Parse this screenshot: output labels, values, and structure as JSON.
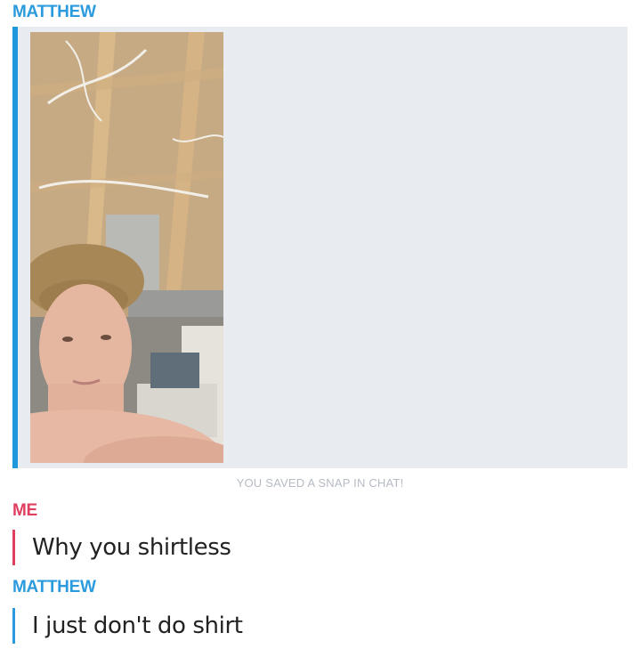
{
  "chat": {
    "senders": {
      "matthew": "MATTHEW",
      "me": "ME"
    },
    "snap": {
      "saved_notice": "YOU SAVED A SNAP IN CHAT!"
    },
    "messages": [
      {
        "sender": "ME",
        "text": "Why you shirtless"
      },
      {
        "sender": "MATTHEW",
        "text": "I just don't do shirt"
      }
    ]
  },
  "colors": {
    "matthew_accent": "#2b9bdd",
    "me_accent": "#e0405f",
    "snap_background": "#e8ebef",
    "notice_text": "#b6bcc4"
  }
}
